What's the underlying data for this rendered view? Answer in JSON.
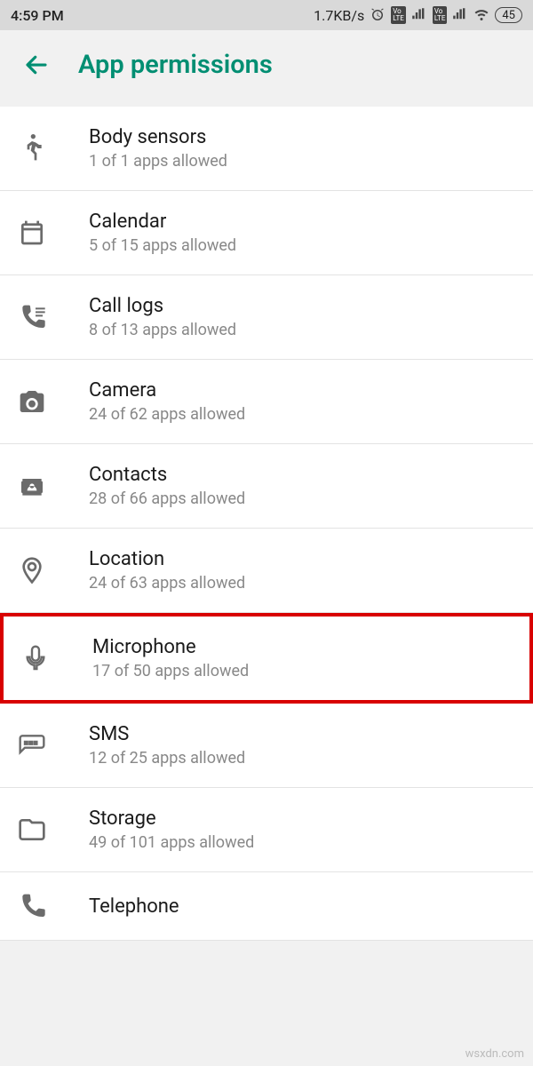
{
  "status_bar": {
    "time": "4:59 PM",
    "data_rate": "1.7KB/s",
    "battery": "45"
  },
  "header": {
    "title": "App permissions"
  },
  "permissions": [
    {
      "id": "body-sensors",
      "title": "Body sensors",
      "subtitle": "1 of 1 apps allowed",
      "icon": "running",
      "highlighted": false
    },
    {
      "id": "calendar",
      "title": "Calendar",
      "subtitle": "5 of 15 apps allowed",
      "icon": "calendar",
      "highlighted": false
    },
    {
      "id": "call-logs",
      "title": "Call logs",
      "subtitle": "8 of 13 apps allowed",
      "icon": "phone-list",
      "highlighted": false
    },
    {
      "id": "camera",
      "title": "Camera",
      "subtitle": "24 of 62 apps allowed",
      "icon": "camera",
      "highlighted": false
    },
    {
      "id": "contacts",
      "title": "Contacts",
      "subtitle": "28 of 66 apps allowed",
      "icon": "contacts",
      "highlighted": false
    },
    {
      "id": "location",
      "title": "Location",
      "subtitle": "24 of 63 apps allowed",
      "icon": "location",
      "highlighted": false
    },
    {
      "id": "microphone",
      "title": "Microphone",
      "subtitle": "17 of 50 apps allowed",
      "icon": "microphone",
      "highlighted": true
    },
    {
      "id": "sms",
      "title": "SMS",
      "subtitle": "12 of 25 apps allowed",
      "icon": "sms",
      "highlighted": false
    },
    {
      "id": "storage",
      "title": "Storage",
      "subtitle": "49 of 101 apps allowed",
      "icon": "folder",
      "highlighted": false
    },
    {
      "id": "telephone",
      "title": "Telephone",
      "subtitle": "",
      "icon": "phone",
      "highlighted": false
    }
  ],
  "watermark": "wsxdn.com"
}
